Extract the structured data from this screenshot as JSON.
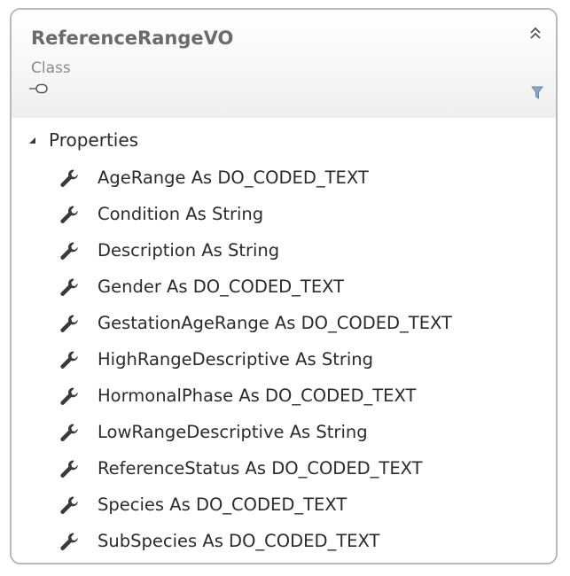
{
  "class_box": {
    "title": "ReferenceRangeVO",
    "stereotype": "Class",
    "section": {
      "label": "Properties",
      "members": [
        {
          "text": "AgeRange As DO_CODED_TEXT",
          "icon": "wrench-icon"
        },
        {
          "text": "Condition As String",
          "icon": "wrench-icon"
        },
        {
          "text": "Description As String",
          "icon": "wrench-icon"
        },
        {
          "text": "Gender As DO_CODED_TEXT",
          "icon": "wrench-icon"
        },
        {
          "text": "GestationAgeRange As DO_CODED_TEXT",
          "icon": "wrench-icon"
        },
        {
          "text": "HighRangeDescriptive As String",
          "icon": "wrench-icon"
        },
        {
          "text": "HormonalPhase As DO_CODED_TEXT",
          "icon": "wrench-icon"
        },
        {
          "text": "LowRangeDescriptive As String",
          "icon": "wrench-icon"
        },
        {
          "text": "ReferenceStatus As DO_CODED_TEXT",
          "icon": "wrench-icon"
        },
        {
          "text": "Species As DO_CODED_TEXT",
          "icon": "wrench-icon"
        },
        {
          "text": "SubSpecies As DO_CODED_TEXT",
          "icon": "wrench-icon"
        }
      ]
    }
  },
  "colors": {
    "border": "#b9b9b9",
    "title": "#6b6b6b",
    "text": "#2b2b2b",
    "icon_dark": "#3a3a3a",
    "filter_blue": "#8aa7c8"
  }
}
